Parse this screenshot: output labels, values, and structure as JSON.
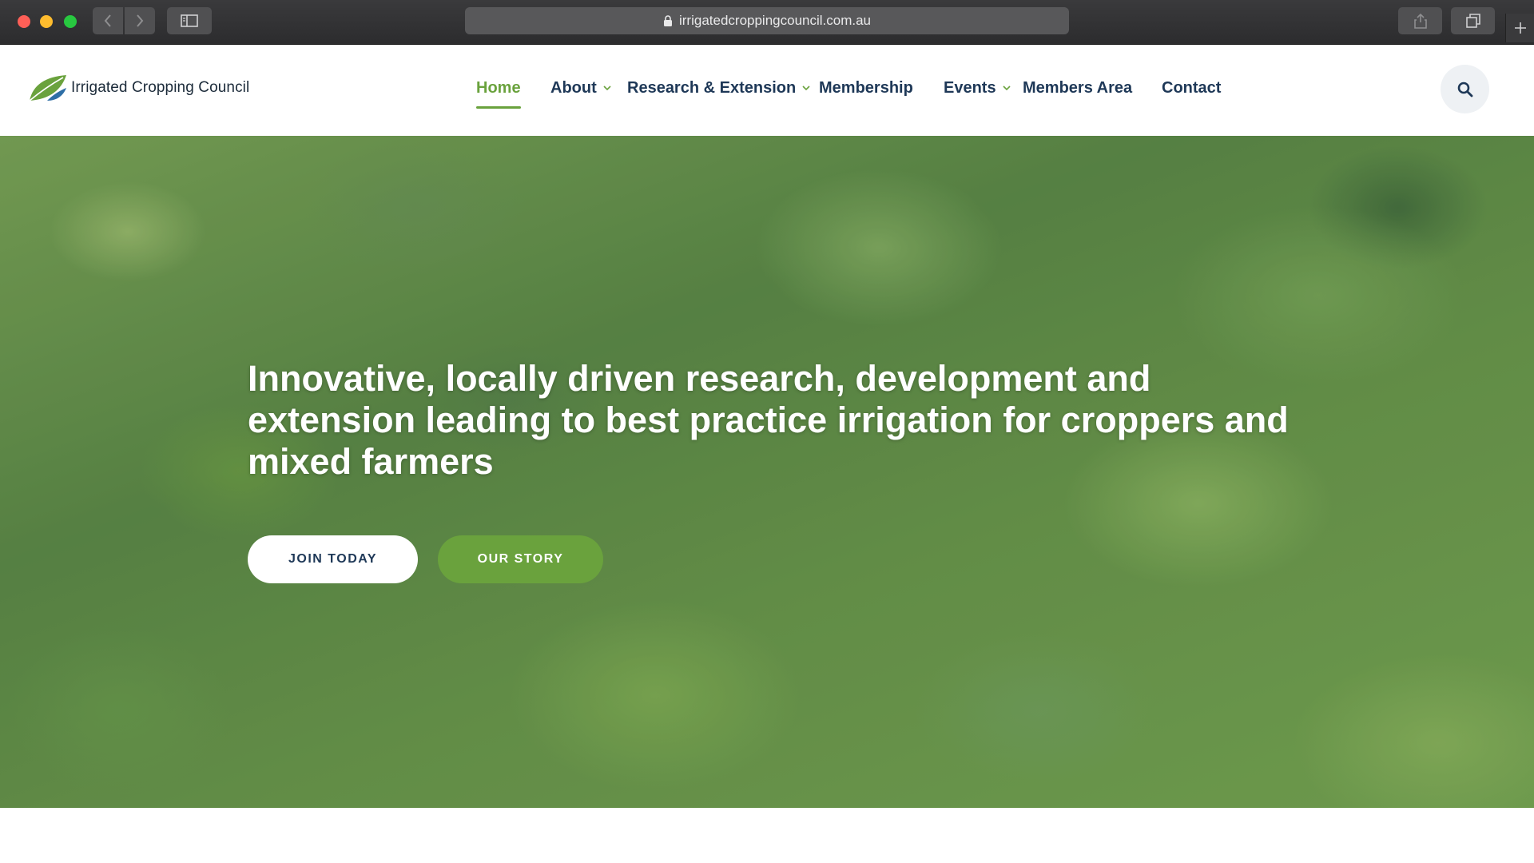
{
  "browser": {
    "url": "irrigatedcroppingcouncil.com.au"
  },
  "site": {
    "logo_text": "Irrigated Cropping Council",
    "brand_green": "#6aa23d",
    "nav_color": "#1e3857"
  },
  "nav": {
    "items": [
      {
        "label": "Home",
        "active": true
      },
      {
        "label": "About",
        "dropdown": true
      },
      {
        "label": "Research & Extension",
        "dropdown": true
      },
      {
        "label": "Membership"
      },
      {
        "label": "Events",
        "dropdown": true
      },
      {
        "label": "Members Area"
      },
      {
        "label": "Contact"
      }
    ]
  },
  "hero": {
    "heading": "Innovative, locally driven research, development and extension leading to best practice irrigation for croppers and mixed farmers",
    "buttons": {
      "join": "JOIN TODAY",
      "story": "OUR STORY"
    }
  }
}
